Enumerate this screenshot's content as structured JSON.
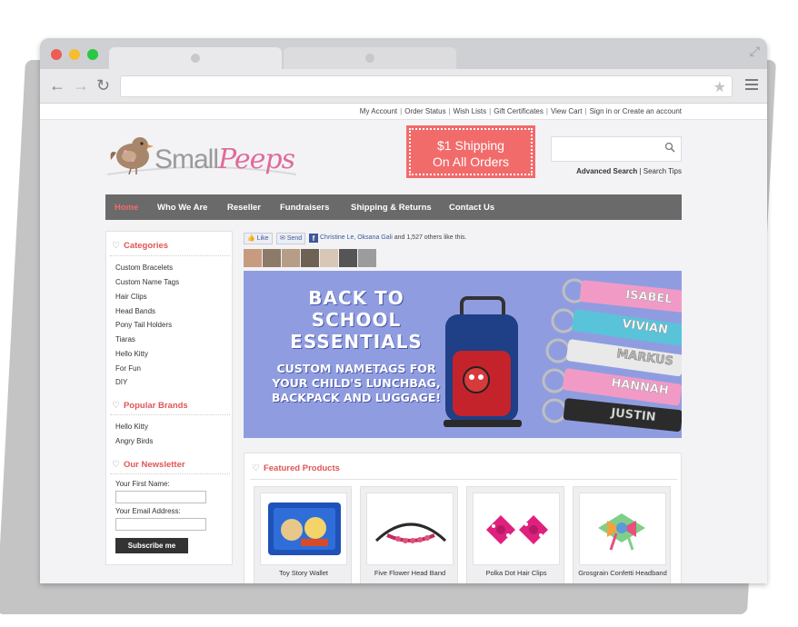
{
  "browser": {
    "url": ""
  },
  "toplinks": {
    "my_account": "My Account",
    "order_status": "Order Status",
    "wish_lists": "Wish Lists",
    "gift_certificates": "Gift Certificates",
    "view_cart": "View Cart",
    "sign_in": "Sign in",
    "or": "or",
    "create_account": "Create an account"
  },
  "logo": {
    "small": "Small",
    "peeps": "Peeps"
  },
  "promo": {
    "line1": "$1 Shipping",
    "line2": "On All Orders"
  },
  "search": {
    "placeholder": "",
    "advanced": "Advanced Search",
    "tips": "Search Tips"
  },
  "nav": [
    {
      "label": "Home"
    },
    {
      "label": "Who We Are"
    },
    {
      "label": "Reseller"
    },
    {
      "label": "Fundraisers"
    },
    {
      "label": "Shipping & Returns"
    },
    {
      "label": "Contact Us"
    }
  ],
  "sidebar": {
    "categories_title": "Categories",
    "categories": [
      {
        "label": "Custom Bracelets"
      },
      {
        "label": "Custom Name Tags"
      },
      {
        "label": "Hair Clips"
      },
      {
        "label": "Head Bands"
      },
      {
        "label": "Pony Tail Holders"
      },
      {
        "label": "Tiaras"
      },
      {
        "label": "Hello Kitty"
      },
      {
        "label": "For Fun"
      },
      {
        "label": "DIY"
      }
    ],
    "brands_title": "Popular Brands",
    "brands": [
      {
        "label": "Hello Kitty"
      },
      {
        "label": "Angry Birds"
      }
    ],
    "newsletter_title": "Our Newsletter",
    "first_name_label": "Your First Name:",
    "email_label": "Your Email Address:",
    "subscribe_label": "Subscribe me"
  },
  "social": {
    "like": "Like",
    "send": "Send",
    "names": "Christine Le, Oksana Gali",
    "others": " and 1,527 others like this."
  },
  "banner": {
    "line1": "BACK TO SCHOOL",
    "line2": "ESSENTIALS",
    "line3": "CUSTOM NAMETAGS FOR",
    "line4": "YOUR CHILD'S LUNCHBAG,",
    "line5": "BACKPACK AND LUGGAGE!",
    "tags": [
      "ISABEL",
      "VIVIAN",
      "MARKUS",
      "HANNAH",
      "JUSTIN"
    ]
  },
  "featured": {
    "title": "Featured Products",
    "products": [
      {
        "name": "Toy Story Wallet"
      },
      {
        "name": "Five Flower Head Band"
      },
      {
        "name": "Polka Dot Hair Clips"
      },
      {
        "name": "Grosgrain Confetti Headband"
      }
    ]
  },
  "colors": {
    "accent": "#f26b6b",
    "nav_bg": "#6a6a6a",
    "heading": "#e05555",
    "banner_bg": "#8f9de0"
  }
}
